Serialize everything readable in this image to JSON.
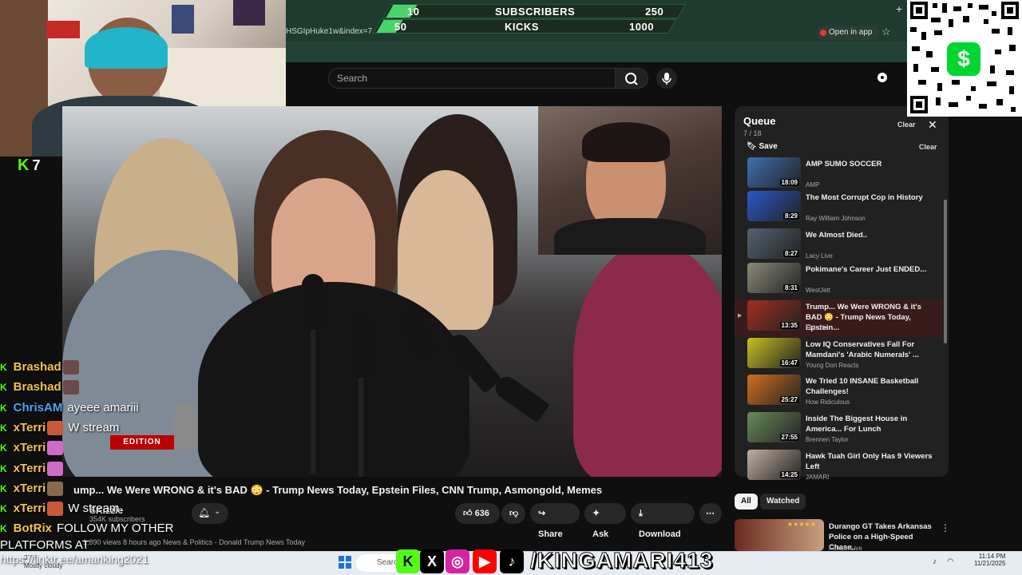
{
  "stream_overlay": {
    "counter": {
      "row1": {
        "left": "10",
        "label": "SUBSCRIBERS",
        "right": "250"
      },
      "row2": {
        "left": "50",
        "label": "KICKS",
        "right": "1000"
      }
    },
    "kick_viewers": "7",
    "brand_name": "/KINGAMARI413",
    "platforms_text": "PLATFORMS AT",
    "linktree_text": "https://linktr.ee/amariking2021"
  },
  "browser": {
    "url_fragment": "HSGIpHuke1w&index=7",
    "open_in_app": "Open in app"
  },
  "youtube": {
    "search_placeholder": "Search",
    "video": {
      "title": "ump... We Were WRONG & it's BAD 😳 - Trump News Today, Epstein Files, CNN Trump, Asmongold, Memes",
      "channel_name": "SKizzle",
      "subscribers": "354K subscribers",
      "views_text": "1,890 views  8 hours ago",
      "category": "News & Politics - Donald Trump News Today",
      "likes": "636",
      "share_label": "Share",
      "ask_label": "Ask",
      "download_label": "Download",
      "watermark": "EDITION"
    },
    "queue": {
      "title": "Queue",
      "count": "7 / 18",
      "clear_top": "Clear",
      "save_label": "Save",
      "clear_label": "Clear",
      "items": [
        {
          "title": "AMP SUMO SOCCER",
          "channel": "AMP",
          "duration": "18:09",
          "color": "#3f6fb0"
        },
        {
          "title": "The Most Corrupt Cop in History",
          "channel": "Ray William Johnson",
          "duration": "8:29",
          "color": "#2a58c8"
        },
        {
          "title": "We Almost Died..",
          "channel": "Lacy Live",
          "duration": "8:27",
          "color": "#556270"
        },
        {
          "title": "Pokimane's Career Just ENDED...",
          "channel": "WestJett",
          "duration": "8:31",
          "color": "#8a8a7a"
        },
        {
          "title": "Trump... We Were WRONG & it's BAD 😳 - Trump News Today, Epstein...",
          "channel": "SKizzle",
          "duration": "13:35",
          "color": "#a03020"
        },
        {
          "title": "Low IQ Conservatives Fall For Mamdani's 'Arabic Numerals' ...",
          "channel": "Young Don Reacts",
          "duration": "16:47",
          "color": "#c8c020"
        },
        {
          "title": "We Tried 10 INSANE Basketball Challenges!",
          "channel": "How Ridiculous",
          "duration": "25:27",
          "color": "#d07020"
        },
        {
          "title": "Inside The Biggest House in America... For Lunch",
          "channel": "Brennen Taylor",
          "duration": "27:55",
          "color": "#6a8a5a"
        },
        {
          "title": "Hawk Tuah Girl Only Has 9 Viewers Left",
          "channel": "JAMARI",
          "duration": "14:25",
          "color": "#c0b0a0"
        }
      ]
    },
    "chips": {
      "all": "All",
      "watched": "Watched"
    },
    "recommended": {
      "title": "Durango GT Takes Arkansas Police on a High-Speed Chase..",
      "channel": "Fanum Live",
      "stars": "★★★★★"
    }
  },
  "chat": [
    {
      "user": "Brashad",
      "color": "#f3c24d",
      "message": ""
    },
    {
      "user": "Brashad",
      "color": "#f3c24d",
      "message": ""
    },
    {
      "user": "ChrisAM",
      "color": "#4fa3f7",
      "message": "ayeee amariii"
    },
    {
      "user": "xTerri",
      "color": "#f3c24d",
      "message": "W stream"
    },
    {
      "user": "xTerri",
      "color": "#f3c24d",
      "message": ""
    },
    {
      "user": "xTerri",
      "color": "#f3c24d",
      "message": ""
    },
    {
      "user": "xTerri",
      "color": "#f3c24d",
      "message": ""
    },
    {
      "user": "xTerri",
      "color": "#f3c24d",
      "message": "W stream"
    },
    {
      "user": "BotRix",
      "color": "#f3c24d",
      "message": "FOLLOW MY OTHER"
    }
  ],
  "taskbar": {
    "weather_temp": "37°F",
    "weather": "Mostly cloudy",
    "search": "Search",
    "time": "11:14 PM",
    "date": "11/21/2025"
  },
  "colors": {
    "kick_green": "#53fc18",
    "yt_bg": "#0f0f0f",
    "queue_active": "#3a1b1b",
    "cashapp": "#00d632"
  }
}
